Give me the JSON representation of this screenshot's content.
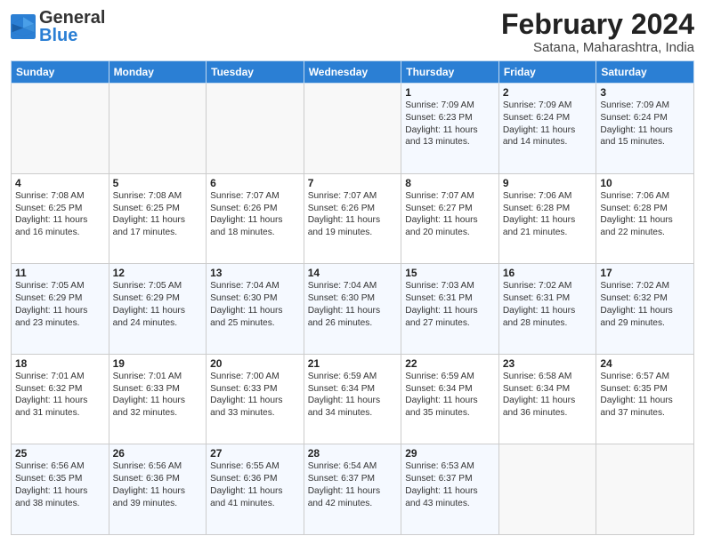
{
  "header": {
    "logo_general": "General",
    "logo_blue": "Blue",
    "main_title": "February 2024",
    "subtitle": "Satana, Maharashtra, India"
  },
  "calendar": {
    "days_of_week": [
      "Sunday",
      "Monday",
      "Tuesday",
      "Wednesday",
      "Thursday",
      "Friday",
      "Saturday"
    ],
    "weeks": [
      [
        {
          "day": "",
          "info": ""
        },
        {
          "day": "",
          "info": ""
        },
        {
          "day": "",
          "info": ""
        },
        {
          "day": "",
          "info": ""
        },
        {
          "day": "1",
          "info": "Sunrise: 7:09 AM\nSunset: 6:23 PM\nDaylight: 11 hours\nand 13 minutes."
        },
        {
          "day": "2",
          "info": "Sunrise: 7:09 AM\nSunset: 6:24 PM\nDaylight: 11 hours\nand 14 minutes."
        },
        {
          "day": "3",
          "info": "Sunrise: 7:09 AM\nSunset: 6:24 PM\nDaylight: 11 hours\nand 15 minutes."
        }
      ],
      [
        {
          "day": "4",
          "info": "Sunrise: 7:08 AM\nSunset: 6:25 PM\nDaylight: 11 hours\nand 16 minutes."
        },
        {
          "day": "5",
          "info": "Sunrise: 7:08 AM\nSunset: 6:25 PM\nDaylight: 11 hours\nand 17 minutes."
        },
        {
          "day": "6",
          "info": "Sunrise: 7:07 AM\nSunset: 6:26 PM\nDaylight: 11 hours\nand 18 minutes."
        },
        {
          "day": "7",
          "info": "Sunrise: 7:07 AM\nSunset: 6:26 PM\nDaylight: 11 hours\nand 19 minutes."
        },
        {
          "day": "8",
          "info": "Sunrise: 7:07 AM\nSunset: 6:27 PM\nDaylight: 11 hours\nand 20 minutes."
        },
        {
          "day": "9",
          "info": "Sunrise: 7:06 AM\nSunset: 6:28 PM\nDaylight: 11 hours\nand 21 minutes."
        },
        {
          "day": "10",
          "info": "Sunrise: 7:06 AM\nSunset: 6:28 PM\nDaylight: 11 hours\nand 22 minutes."
        }
      ],
      [
        {
          "day": "11",
          "info": "Sunrise: 7:05 AM\nSunset: 6:29 PM\nDaylight: 11 hours\nand 23 minutes."
        },
        {
          "day": "12",
          "info": "Sunrise: 7:05 AM\nSunset: 6:29 PM\nDaylight: 11 hours\nand 24 minutes."
        },
        {
          "day": "13",
          "info": "Sunrise: 7:04 AM\nSunset: 6:30 PM\nDaylight: 11 hours\nand 25 minutes."
        },
        {
          "day": "14",
          "info": "Sunrise: 7:04 AM\nSunset: 6:30 PM\nDaylight: 11 hours\nand 26 minutes."
        },
        {
          "day": "15",
          "info": "Sunrise: 7:03 AM\nSunset: 6:31 PM\nDaylight: 11 hours\nand 27 minutes."
        },
        {
          "day": "16",
          "info": "Sunrise: 7:02 AM\nSunset: 6:31 PM\nDaylight: 11 hours\nand 28 minutes."
        },
        {
          "day": "17",
          "info": "Sunrise: 7:02 AM\nSunset: 6:32 PM\nDaylight: 11 hours\nand 29 minutes."
        }
      ],
      [
        {
          "day": "18",
          "info": "Sunrise: 7:01 AM\nSunset: 6:32 PM\nDaylight: 11 hours\nand 31 minutes."
        },
        {
          "day": "19",
          "info": "Sunrise: 7:01 AM\nSunset: 6:33 PM\nDaylight: 11 hours\nand 32 minutes."
        },
        {
          "day": "20",
          "info": "Sunrise: 7:00 AM\nSunset: 6:33 PM\nDaylight: 11 hours\nand 33 minutes."
        },
        {
          "day": "21",
          "info": "Sunrise: 6:59 AM\nSunset: 6:34 PM\nDaylight: 11 hours\nand 34 minutes."
        },
        {
          "day": "22",
          "info": "Sunrise: 6:59 AM\nSunset: 6:34 PM\nDaylight: 11 hours\nand 35 minutes."
        },
        {
          "day": "23",
          "info": "Sunrise: 6:58 AM\nSunset: 6:34 PM\nDaylight: 11 hours\nand 36 minutes."
        },
        {
          "day": "24",
          "info": "Sunrise: 6:57 AM\nSunset: 6:35 PM\nDaylight: 11 hours\nand 37 minutes."
        }
      ],
      [
        {
          "day": "25",
          "info": "Sunrise: 6:56 AM\nSunset: 6:35 PM\nDaylight: 11 hours\nand 38 minutes."
        },
        {
          "day": "26",
          "info": "Sunrise: 6:56 AM\nSunset: 6:36 PM\nDaylight: 11 hours\nand 39 minutes."
        },
        {
          "day": "27",
          "info": "Sunrise: 6:55 AM\nSunset: 6:36 PM\nDaylight: 11 hours\nand 41 minutes."
        },
        {
          "day": "28",
          "info": "Sunrise: 6:54 AM\nSunset: 6:37 PM\nDaylight: 11 hours\nand 42 minutes."
        },
        {
          "day": "29",
          "info": "Sunrise: 6:53 AM\nSunset: 6:37 PM\nDaylight: 11 hours\nand 43 minutes."
        },
        {
          "day": "",
          "info": ""
        },
        {
          "day": "",
          "info": ""
        }
      ]
    ]
  }
}
